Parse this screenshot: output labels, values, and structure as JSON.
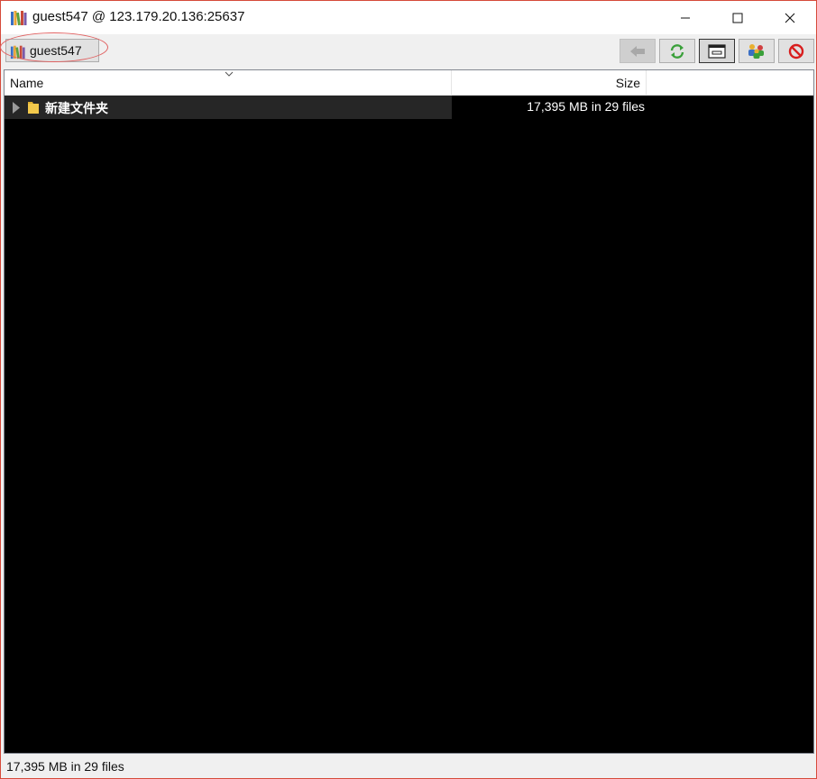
{
  "window": {
    "title": "guest547 @ 123.179.20.136:25637",
    "app_icon": "books-icon",
    "controls": [
      "minimize-icon",
      "maximize-icon",
      "close-icon"
    ]
  },
  "toolbar": {
    "user_tab_label": "guest547",
    "user_tab_icon": "books-icon",
    "buttons": [
      {
        "name": "back-button",
        "icon": "back-arrow-icon",
        "enabled": false
      },
      {
        "name": "refresh-button",
        "icon": "refresh-icon",
        "enabled": true
      },
      {
        "name": "view-button",
        "icon": "window-view-icon",
        "enabled": true,
        "pressed": true
      },
      {
        "name": "users-button",
        "icon": "users-icon",
        "enabled": true
      },
      {
        "name": "disconnect-button",
        "icon": "no-entry-icon",
        "enabled": true
      }
    ]
  },
  "list": {
    "columns": {
      "name": "Name",
      "size": "Size"
    },
    "sort_indicator": "chevron-down-icon",
    "rows": [
      {
        "name": "新建文件夹",
        "size": "17,395 MB in 29 files",
        "type": "folder"
      }
    ]
  },
  "status": {
    "text": "17,395 MB in 29 files"
  },
  "colors": {
    "list_background": "#000000",
    "selected_row": "#262626",
    "window_border": "#d64a3a"
  }
}
